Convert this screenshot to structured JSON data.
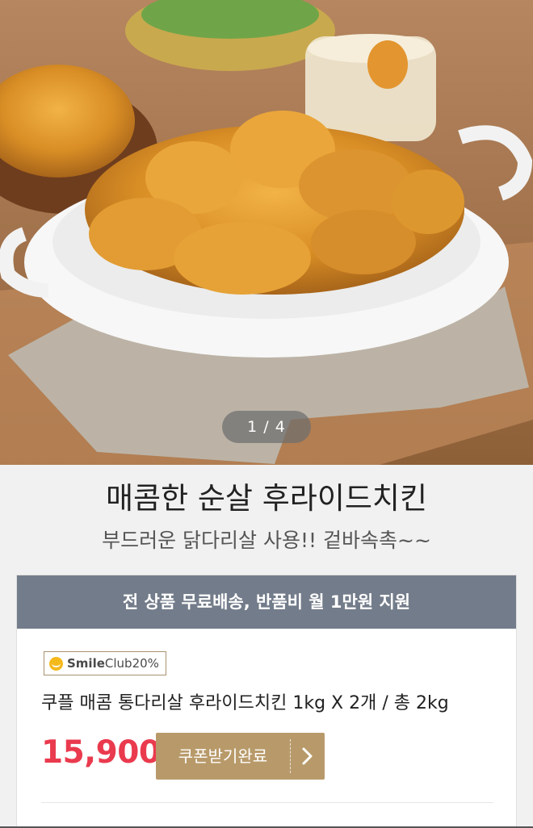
{
  "gallery": {
    "image_description": "crispy boneless fried chicken in white oval dish",
    "pager_current": "1",
    "pager_total": "4",
    "pager_text": "1 / 4"
  },
  "product": {
    "title": "매콤한 순살 후라이드치킨",
    "subtitle": "부드러운 닭다리살 사용!! 겉바속촉~~",
    "name": "쿠플 매콤 통다리살 후라이드치킨 1kg X 2개 / 총 2kg",
    "price": "15,900"
  },
  "promo": {
    "banner_text": "전 상품 무료배송, 반품비 월 1만원 지원"
  },
  "badge": {
    "smile_bold": "Smile",
    "smile_light": "Club",
    "percent": "20%"
  },
  "coupon_button": {
    "label": "쿠폰받기완료"
  },
  "colors": {
    "price": "#ea3a4e",
    "banner": "#737c8a",
    "coupon_button": "#b89a6a",
    "smile_icon": "#f4b91b"
  },
  "icons": {
    "coupon_arrow": "chevron-right-icon",
    "smile": "smile-icon"
  }
}
